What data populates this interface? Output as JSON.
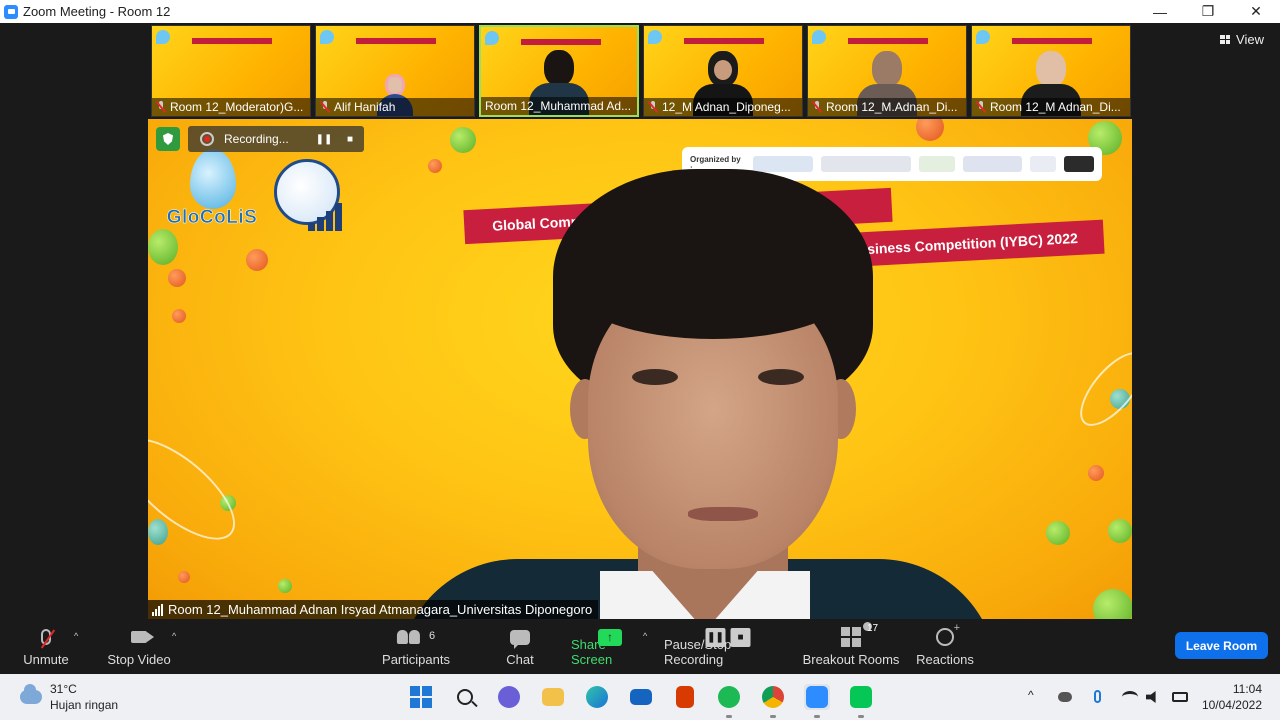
{
  "window": {
    "title": "Zoom Meeting - Room 12",
    "minimize": "—",
    "restore": "❐",
    "close": "✕"
  },
  "view_button": {
    "label": "View"
  },
  "thumbnails": [
    {
      "name": "Room 12_Moderator)G...",
      "muted": true
    },
    {
      "name": "Alif Hanifah",
      "muted": true
    },
    {
      "name": "Room 12_Muhammad Ad...",
      "muted": false,
      "active": true
    },
    {
      "name": "12_M Adnan_Diponeg...",
      "muted": true
    },
    {
      "name": "Room 12_M.Adnan_Di...",
      "muted": true
    },
    {
      "name": "Room 12_M Adnan_Di...",
      "muted": true
    }
  ],
  "main_video": {
    "recording_label": "Recording...",
    "pause_icon": "❚❚",
    "stop_icon": "■",
    "logo_text": "GloCoLiS",
    "organized_by": "Organized by :",
    "banner_line1": "Global Compe                         oLiS) 2022",
    "banner_line2": "siness Competition (IYBC) 2022",
    "speaker_name": "Room 12_Muhammad Adnan Irsyad Atmanagara_Universitas Diponegoro"
  },
  "toolbar": {
    "unmute": "Unmute",
    "stop_video": "Stop Video",
    "participants": "Participants",
    "participants_count": "6",
    "chat": "Chat",
    "share_screen": "Share Screen",
    "pause_stop_recording": "Pause/Stop Recording",
    "breakout_rooms": "Breakout Rooms",
    "breakout_badge": "17",
    "reactions": "Reactions",
    "leave_room": "Leave Room",
    "caret": "^",
    "share_arrow": "↑"
  },
  "taskbar": {
    "temperature": "31°C",
    "weather_desc": "Hujan ringan",
    "time": "11:04",
    "date": "10/04/2022",
    "apps": [
      "windows-start",
      "search",
      "teams-chat",
      "file-explorer",
      "edge",
      "mail",
      "office",
      "spotify",
      "chrome",
      "zoom",
      "line"
    ],
    "tray_chevron": "^"
  },
  "colors": {
    "accent_blue": "#0e71eb",
    "share_green": "#23d959",
    "banner_red": "#c81f3e",
    "background_yellow": "#ffc414"
  }
}
